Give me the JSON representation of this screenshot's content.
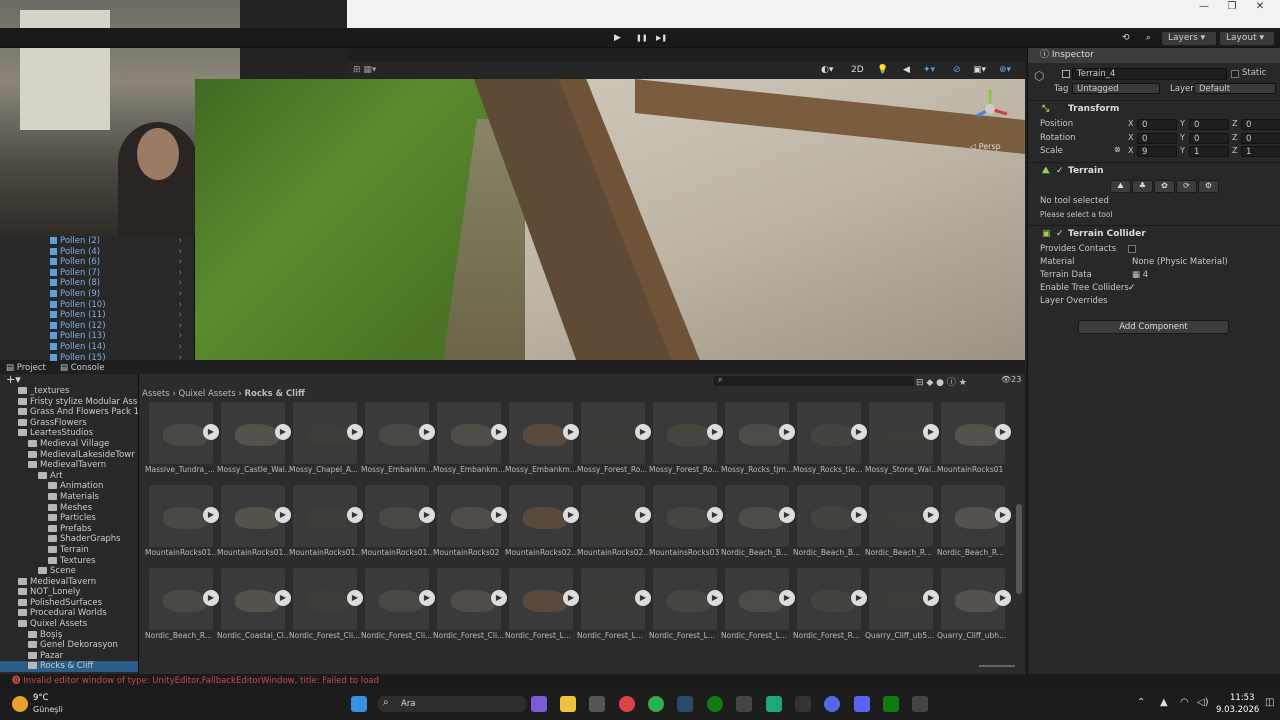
{
  "toolbar": {
    "layers_label": "Layers",
    "layout_label": "Layout",
    "play": "▶",
    "pause": "❚❚",
    "step": "▶❚"
  },
  "hierarchy": {
    "items": [
      "Pollen (2)",
      "Pollen (4)",
      "Pollen (6)",
      "Pollen (7)",
      "Pollen (8)",
      "Pollen (9)",
      "Pollen (10)",
      "Pollen (11)",
      "Pollen (12)",
      "Pollen (13)",
      "Pollen (14)",
      "Pollen (15)"
    ]
  },
  "scene": {
    "mode_2d": "2D",
    "persp_label": "◁ Persp"
  },
  "inspector": {
    "tab_label": "Inspector",
    "object_name": "Terrain_4",
    "static_label": "Static",
    "tag_label": "Tag",
    "tag_value": "Untagged",
    "layer_label": "Layer",
    "layer_value": "Default",
    "transform": {
      "title": "Transform",
      "position_label": "Position",
      "rotation_label": "Rotation",
      "scale_label": "Scale",
      "position": [
        "0",
        "0",
        "0"
      ],
      "rotation": [
        "0",
        "0",
        "0"
      ],
      "scale": [
        "9",
        "1",
        "1"
      ],
      "axis": [
        "X",
        "Y",
        "Z"
      ]
    },
    "terrain": {
      "title": "Terrain",
      "no_tool": "No tool selected",
      "hint": "Please select a tool"
    },
    "collider": {
      "title": "Terrain Collider",
      "provides_contacts": "Provides Contacts",
      "material_label": "Material",
      "material_value": "None (Physic Material)",
      "terrain_data_label": "Terrain Data",
      "terrain_data_value": "4",
      "enable_tree": "Enable Tree Colliders",
      "layer_overrides": "Layer Overrides"
    },
    "add_component": "Add Component"
  },
  "bottom": {
    "project_tab": "Project",
    "console_tab": "Console",
    "item_count": "23"
  },
  "project_tree": [
    {
      "label": "_textures",
      "indent": 1
    },
    {
      "label": "Fristy stylize Modular Asse",
      "indent": 1
    },
    {
      "label": "Grass And Flowers Pack 1",
      "indent": 1
    },
    {
      "label": "GrassFlowers",
      "indent": 1
    },
    {
      "label": "LeartesStudios",
      "indent": 1
    },
    {
      "label": "Medieval Village",
      "indent": 2
    },
    {
      "label": "MedievalLakesideTowr",
      "indent": 2
    },
    {
      "label": "MedievalTavern",
      "indent": 2
    },
    {
      "label": "Art",
      "indent": 3
    },
    {
      "label": "Animation",
      "indent": 4
    },
    {
      "label": "Materials",
      "indent": 4
    },
    {
      "label": "Meshes",
      "indent": 4
    },
    {
      "label": "Particles",
      "indent": 4
    },
    {
      "label": "Prefabs",
      "indent": 4
    },
    {
      "label": "ShaderGraphs",
      "indent": 4
    },
    {
      "label": "Terrain",
      "indent": 4
    },
    {
      "label": "Textures",
      "indent": 4
    },
    {
      "label": "Scene",
      "indent": 3
    },
    {
      "label": "MedievalTavern",
      "indent": 1
    },
    {
      "label": "NOT_Lonely",
      "indent": 1
    },
    {
      "label": "PolishedSurfaces",
      "indent": 1
    },
    {
      "label": "Procedural Worlds",
      "indent": 1
    },
    {
      "label": "Quixel Assets",
      "indent": 1
    },
    {
      "label": "Boşiş",
      "indent": 2
    },
    {
      "label": "Genel Dekorasyon",
      "indent": 2
    },
    {
      "label": "Pazar",
      "indent": 2
    },
    {
      "label": "Rocks & Cliff",
      "indent": 2
    }
  ],
  "breadcrumb": {
    "assets": "Assets",
    "quixel": "Quixel Assets",
    "current": "Rocks & Cliff"
  },
  "assets": [
    "Massive_Tundra_...",
    "Mossy_Castle_Wal...",
    "Mossy_Chapel_A...",
    "Mossy_Embankm...",
    "Mossy_Embankm...",
    "Mossy_Embankm...",
    "Mossy_Forest_Ro...",
    "Mossy_Forest_Ro...",
    "Mossy_Rocks_tjm...",
    "Mossy_Rocks_tie...",
    "Mossy_Stone_Wal...",
    "MountainRocks01",
    "MountainRocks01...",
    "MountainRocks01...",
    "MountainRocks01...",
    "MountainRocks01...",
    "MountainRocks02",
    "MountainRocks02...",
    "MountainRocks02...",
    "MountainsRocks03",
    "Nordic_Beach_B...",
    "Nordic_Beach_B...",
    "Nordic_Beach_R...",
    "Nordic_Beach_R...",
    "Nordic_Beach_R...",
    "Nordic_Coastal_Cl...",
    "Nordic_Forest_Cli...",
    "Nordic_Forest_Cli...",
    "Nordic_Forest_Cli...",
    "Nordic_Forest_L...",
    "Nordic_Forest_L...",
    "Nordic_Forest_L...",
    "Nordic_Forest_L...",
    "Nordic_Forest_R...",
    "Quarry_Cliff_ub5...",
    "Quarry_Cliff_ubh..."
  ],
  "status_message": "Invalid editor window of type: UnityEditor.FallbackEditorWindow, title: Failed to load",
  "taskbar": {
    "weather_temp": "9°C",
    "weather_desc": "Güneşli",
    "search": "Ara",
    "time": "11:53",
    "date": "9.03.2026"
  }
}
